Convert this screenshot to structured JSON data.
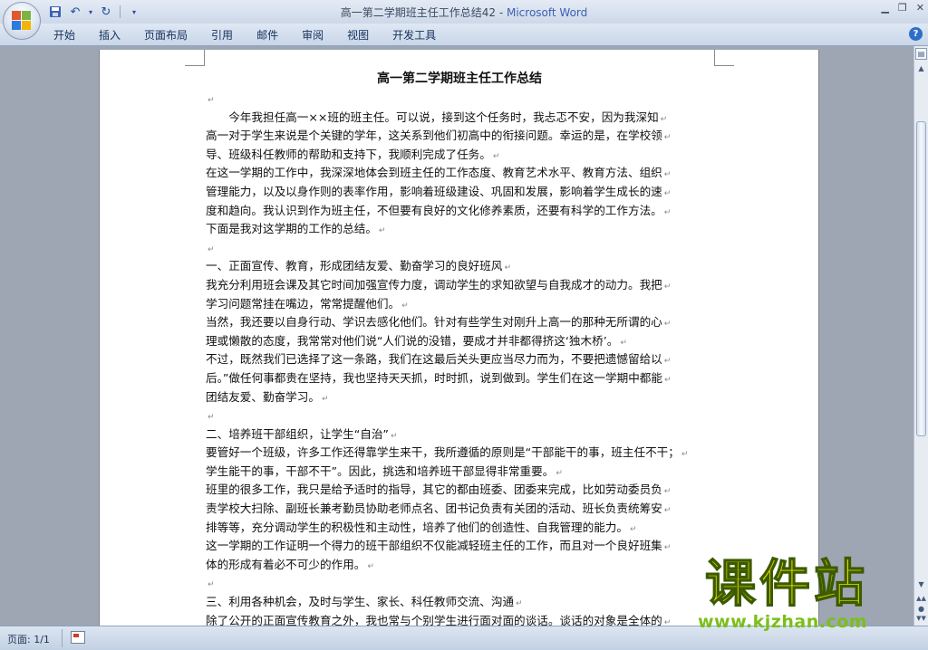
{
  "window": {
    "title": "高一第二学期班主任工作总结42",
    "separator": " - ",
    "app_name": "Microsoft Word"
  },
  "quick_access": {
    "save_icon": "save-icon",
    "undo_icon": "undo-icon",
    "redo_icon": "repeat-icon"
  },
  "ribbon": {
    "tabs": [
      "开始",
      "插入",
      "页面布局",
      "引用",
      "邮件",
      "审阅",
      "视图",
      "开发工具"
    ]
  },
  "document": {
    "title": "高一第二学期班主任工作总结",
    "lines": [
      "",
      "　　今年我担任高一××班的班主任。可以说，接到这个任务时，我忐忑不安，因为我深知",
      "高一对于学生来说是个关键的学年，这关系到他们初高中的衔接问题。幸运的是，在学校领",
      "导、班级科任教师的帮助和支持下，我顺利完成了任务。",
      "在这一学期的工作中，我深深地体会到班主任的工作态度、教育艺术水平、教育方法、组织",
      "管理能力，以及以身作则的表率作用，影响着班级建设、巩固和发展，影响着学生成长的速",
      "度和趋向。我认识到作为班主任，不但要有良好的文化修养素质，还要有科学的工作方法。",
      "下面是我对这学期的工作的总结。",
      "",
      "一、正面宣传、教育，形成团结友爱、勤奋学习的良好班风",
      "我充分利用班会课及其它时间加强宣传力度，调动学生的求知欲望与自我成才的动力。我把",
      "学习问题常挂在嘴边，常常提醒他们。",
      "当然，我还要以自身行动、学识去感化他们。针对有些学生对刚升上高一的那种无所谓的心",
      "理或懒散的态度，我常常对他们说“人们说的没错，要成才并非都得挤这‘独木桥’。",
      "不过，既然我们已选择了这一条路，我们在这最后关头更应当尽力而为，不要把遗憾留给以",
      "后。”做任何事都贵在坚持，我也坚持天天抓，时时抓，说到做到。学生们在这一学期中都能",
      "团结友爱、勤奋学习。",
      "",
      "二、培养班干部组织，让学生“自治”",
      "要管好一个班级，许多工作还得靠学生来干，我所遵循的原则是“干部能干的事，班主任不干；",
      "学生能干的事，干部不干”。因此，挑选和培养班干部显得非常重要。",
      "班里的很多工作，我只是给予适时的指导，其它的都由班委、团委来完成，比如劳动委员负",
      "责学校大扫除、副班长兼考勤员协助老师点名、团书记负责有关团的活动、班长负责统筹安",
      "排等等，充分调动学生的积极性和主动性，培养了他们的创造性、自我管理的能力。",
      "这一学期的工作证明一个得力的班干部组织不仅能减轻班主任的工作，而且对一个良好班集",
      "体的形成有着必不可少的作用。",
      "",
      "三、利用各种机会，及时与学生、家长、科任教师交流、沟通",
      "除了公开的正面宣传教育之外，我也常与个别学生进行面对面的谈话。谈话的对象是全体的"
    ],
    "paragraph_mark": "↵"
  },
  "status_bar": {
    "page_count": "页面: 1/1"
  },
  "watermark": {
    "text": "课件站",
    "url": "www.kjzhan.com"
  }
}
